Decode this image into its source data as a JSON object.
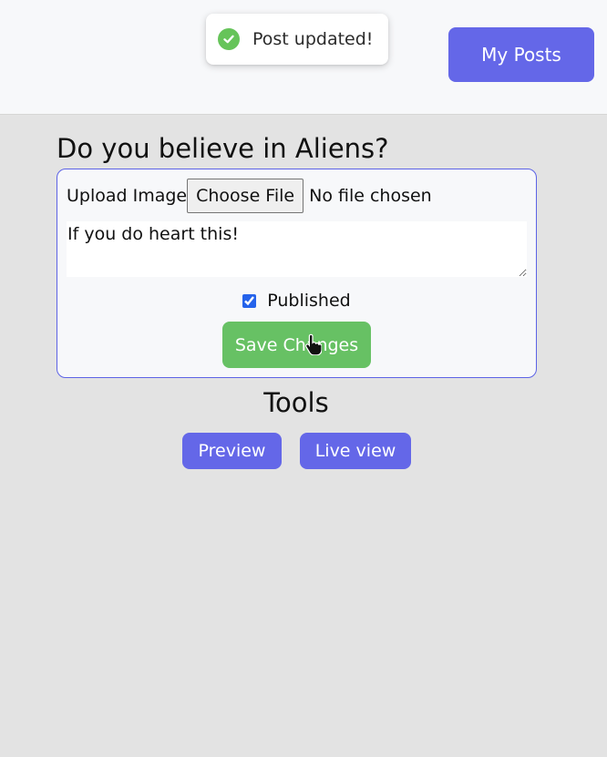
{
  "header": {
    "my_posts_label": "My Posts",
    "accent_color": "#6467e8"
  },
  "toast": {
    "message": "Post updated!",
    "icon": "check-circle-icon",
    "icon_color": "#66c45a"
  },
  "post": {
    "title": "Do you believe in Aliens?",
    "upload_label": "Upload Image",
    "choose_file_label": "Choose File",
    "file_status": "No file chosen",
    "content": "If you do heart this!",
    "published_label": "Published",
    "published": true,
    "save_label": "Save Changes",
    "save_color": "#67c164"
  },
  "tools": {
    "title": "Tools",
    "preview_label": "Preview",
    "live_view_label": "Live view"
  },
  "colors": {
    "page_background": "#e3e3e3",
    "header_background": "#f7f8fa",
    "form_border": "#5d63e6"
  }
}
